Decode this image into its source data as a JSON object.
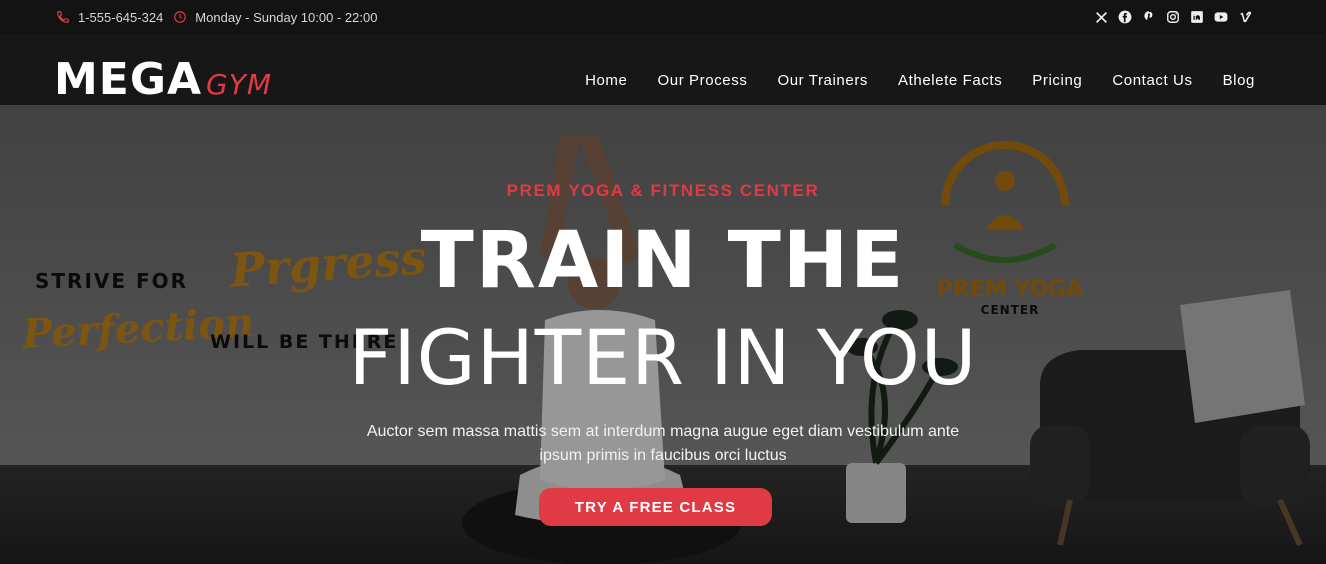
{
  "topbar": {
    "phone": "1-555-645-324",
    "hours": "Monday - Sunday 10:00 - 22:00",
    "social": [
      "x-icon",
      "facebook-icon",
      "pinterest-icon",
      "instagram-icon",
      "linkedin-icon",
      "youtube-icon",
      "vimeo-icon"
    ]
  },
  "logo": {
    "part1": "MEGA",
    "part2": "GYM"
  },
  "nav": {
    "items": [
      "Home",
      "Our Process",
      "Our Trainers",
      "Athelete Facts",
      "Pricing",
      "Contact Us",
      "Blog"
    ]
  },
  "hero": {
    "kicker": "PREM YOGA & FITNESS CENTER",
    "title_line1": "TRAIN THE",
    "title_line2": "FIGHTER IN YOU",
    "description": "Auctor sem massa mattis sem at interdum magna augue eget diam vestibulum ante ipsum primis in faucibus orci luctus",
    "cta": "TRY A FREE CLASS"
  },
  "background_art": {
    "strive": "STRIVE FOR",
    "progress": "Prgress",
    "perfection": "Perfection",
    "will_be_there": "WILL BE THERE",
    "badge_title": "PREM YOGA",
    "badge_subtitle": "CENTER"
  },
  "colors": {
    "accent": "#e03a45",
    "topbar_bg": "#131313",
    "header_bg": "#171717",
    "gold": "#c98a1c"
  }
}
